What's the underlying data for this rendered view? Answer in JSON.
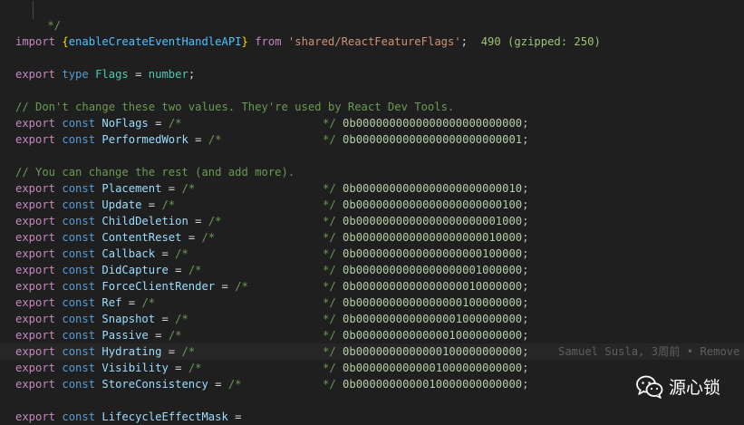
{
  "code": {
    "comment_end": "*/",
    "import_line": {
      "kw_import": "import",
      "brace_open": "{",
      "name": "enableCreateEventHandleAPI",
      "brace_close": "}",
      "kw_from": "from",
      "path": "'shared/ReactFeatureFlags'",
      "semicolon": ";",
      "size_info": "490 (gzipped: 250)"
    },
    "type_line": {
      "kw_export": "export",
      "kw_type": "type",
      "name": "Flags",
      "eq": "=",
      "type_name": "number",
      "semicolon": ";"
    },
    "comment1": "// Don't change these two values. They're used by React Dev Tools.",
    "comment2": "// You can change the rest (and add more).",
    "keywords": {
      "export": "export",
      "const": "const"
    },
    "group1": [
      {
        "name": "NoFlags",
        "value": "0b0000000000000000000000000;"
      },
      {
        "name": "PerformedWork",
        "value": "0b0000000000000000000000001;"
      }
    ],
    "group2": [
      {
        "name": "Placement",
        "value": "0b0000000000000000000000010;"
      },
      {
        "name": "Update",
        "value": "0b0000000000000000000000100;"
      },
      {
        "name": "ChildDeletion",
        "value": "0b0000000000000000000001000;"
      },
      {
        "name": "ContentReset",
        "value": "0b0000000000000000000010000;"
      },
      {
        "name": "Callback",
        "value": "0b0000000000000000000100000;"
      },
      {
        "name": "DidCapture",
        "value": "0b0000000000000000001000000;"
      },
      {
        "name": "ForceClientRender",
        "value": "0b0000000000000000010000000;"
      },
      {
        "name": "Ref",
        "value": "0b0000000000000000100000000;"
      },
      {
        "name": "Snapshot",
        "value": "0b0000000000000001000000000;"
      },
      {
        "name": "Passive",
        "value": "0b0000000000000010000000000;"
      },
      {
        "name": "Hydrating",
        "value": "0b0000000000000100000000000;"
      },
      {
        "name": "Visibility",
        "value": "0b0000000000001000000000000;"
      },
      {
        "name": "StoreConsistency",
        "value": "0b0000000000010000000000000;"
      }
    ],
    "last_line": {
      "name": "LifecycleEffectMask",
      "eq": "="
    },
    "eq": "=",
    "comment_open": "/*",
    "comment_close": "*/",
    "blame": "Samuel Susla, 3周前 • Remove"
  },
  "watermark": {
    "text": "源心锁",
    "icon": "wechat-icon"
  },
  "colors": {
    "background": "#1f1f1f",
    "keyword": "#c586c0",
    "storage": "#569cd6",
    "identifier": "#9cdcfe",
    "comment": "#6a9955",
    "string": "#ce9178",
    "number": "#b5cea8"
  }
}
